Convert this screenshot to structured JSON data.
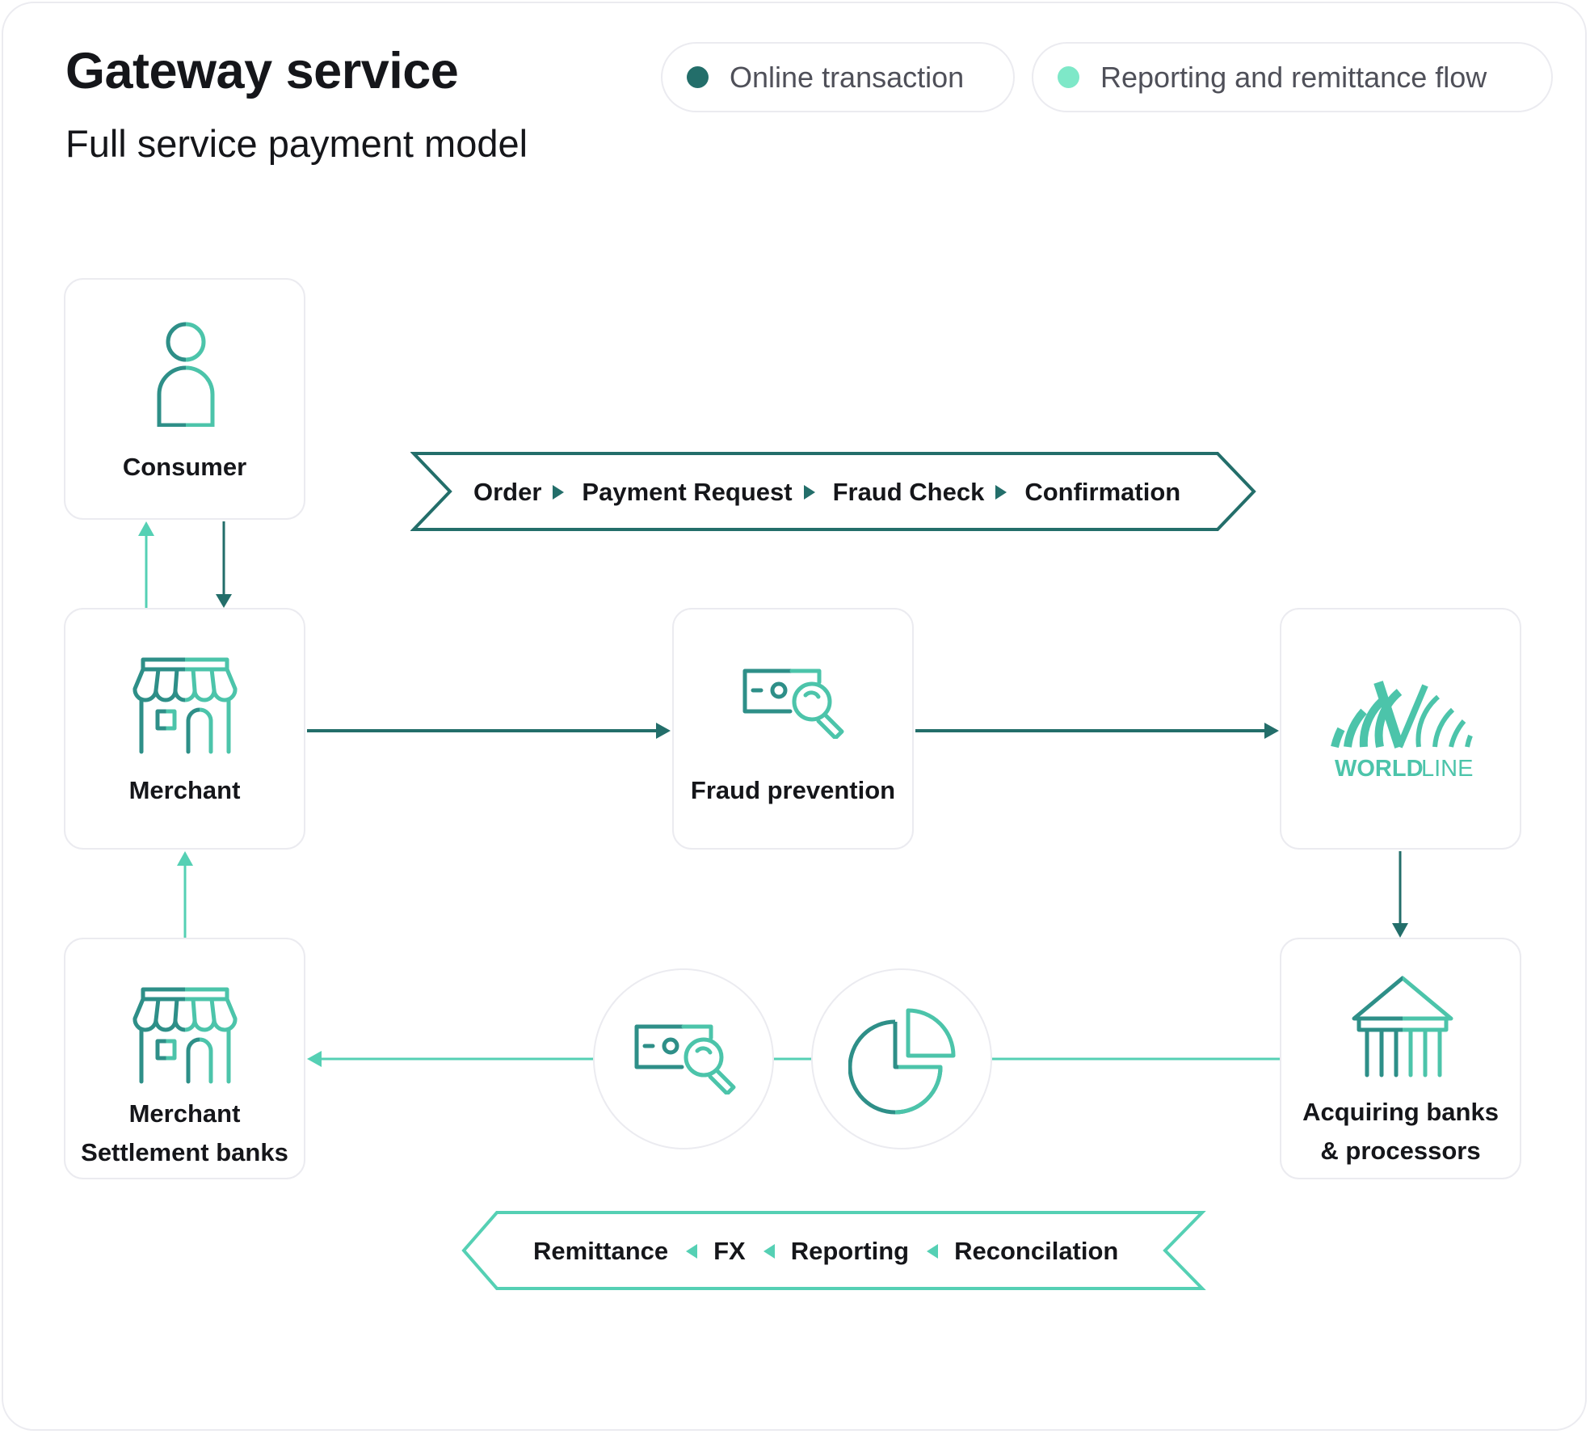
{
  "header": {
    "title": "Gateway service",
    "subtitle": "Full service payment model"
  },
  "legend": [
    {
      "label": "Online transaction",
      "color": "#236e6a"
    },
    {
      "label": "Reporting and remittance flow",
      "color": "#7ee8c8"
    }
  ],
  "colors": {
    "online": "#236e6a",
    "reporting": "#55d0b4",
    "icon_dark": "#2e8f88",
    "icon_light": "#4cc4aa",
    "card_border": "#ebebf0",
    "text": "#15161a"
  },
  "nodes": {
    "consumer": {
      "label": "Consumer",
      "icon": "person-icon"
    },
    "merchant": {
      "label": "Merchant",
      "icon": "storefront-icon"
    },
    "fraud": {
      "label": "Fraud prevention",
      "icon": "card-search-icon"
    },
    "worldline": {
      "logo_bold": "WORLD",
      "logo_light": "LINE",
      "icon": "worldline-logo"
    },
    "settlement": {
      "label_line1": "Merchant",
      "label_line2": "Settlement banks",
      "icon": "storefront-icon"
    },
    "acquiring": {
      "label_line1": "Acquiring banks",
      "label_line2": "& processors",
      "icon": "bank-icon"
    }
  },
  "online_flow": {
    "steps": [
      "Order",
      "Payment Request",
      "Fraud Check",
      "Confirmation"
    ]
  },
  "reporting_flow": {
    "steps": [
      "Remittance",
      "FX",
      "Reporting",
      "Reconcilation"
    ]
  },
  "intermediate_icons": [
    "card-search-icon",
    "pie-chart-icon"
  ]
}
